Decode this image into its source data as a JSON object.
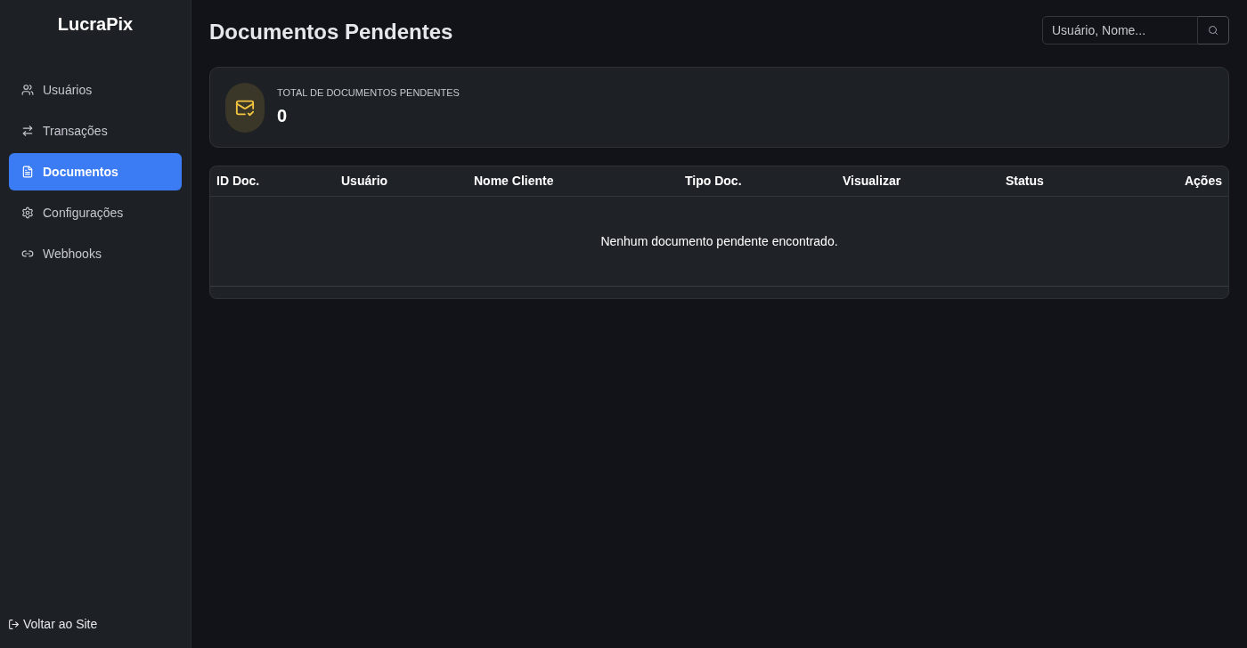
{
  "sidebar": {
    "brand": "LucraPix",
    "items": [
      {
        "label": "Usuários",
        "selected": false
      },
      {
        "label": "Transações",
        "selected": false
      },
      {
        "label": "Documentos",
        "selected": true
      },
      {
        "label": "Configurações",
        "selected": false
      },
      {
        "label": "Webhooks",
        "selected": false
      }
    ],
    "footer_link": "Voltar ao Site"
  },
  "header": {
    "title": "Documentos Pendentes",
    "search": {
      "placeholder": "Usuário, Nome..."
    }
  },
  "stat_card": {
    "label": "TOTAL DE DOCUMENTOS PENDENTES",
    "value": "0"
  },
  "table": {
    "columns": [
      "ID Doc.",
      "Usuário",
      "Nome Cliente",
      "Tipo Doc.",
      "Visualizar",
      "Status",
      "Ações"
    ],
    "empty_message": "Nenhum documento pendente encontrado."
  }
}
